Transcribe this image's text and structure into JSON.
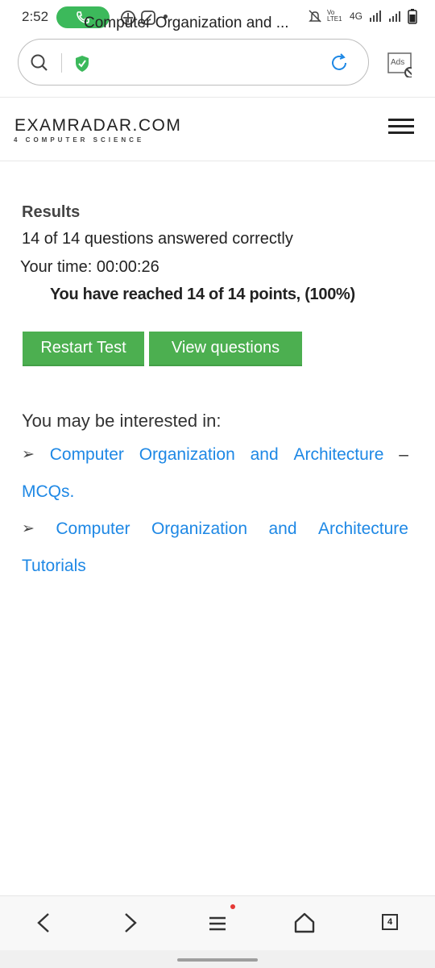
{
  "status_bar": {
    "time": "2:52",
    "network": "4G",
    "volte": "Vo LTE1",
    "tab_count": "4"
  },
  "url_bar": {
    "title": "Computer Organization and ...",
    "ads_label": "Ads"
  },
  "site": {
    "name": "EXAMRADAR.COM",
    "tagline": "4 COMPUTER SCIENCE"
  },
  "results": {
    "heading": "Results",
    "correct": "14 of 14 questions answered correctly",
    "time": "Your time: 00:00:26",
    "points": "You have reached 14 of 14 points, (100%)",
    "restart_label": "Restart Test",
    "view_label": "View questions"
  },
  "interested": {
    "heading": "You may be interested in:",
    "links": [
      {
        "words": [
          "Computer",
          "Organization",
          "and",
          "Architecture",
          "–"
        ],
        "tail": "MCQs."
      },
      {
        "words": [
          "Computer",
          "Organization",
          "and",
          "Architecture"
        ],
        "tail": "Tutorials"
      }
    ]
  },
  "colors": {
    "accent_green": "#4caf50",
    "link_blue": "#1e88e5",
    "call_green": "#3cb95b"
  },
  "icons": [
    "phone-icon",
    "search-icon",
    "shield-check-icon",
    "reload-icon",
    "ads-block-icon",
    "hamburger-menu-icon",
    "back-icon",
    "forward-icon",
    "menu-icon",
    "home-icon",
    "tabs-icon"
  ]
}
